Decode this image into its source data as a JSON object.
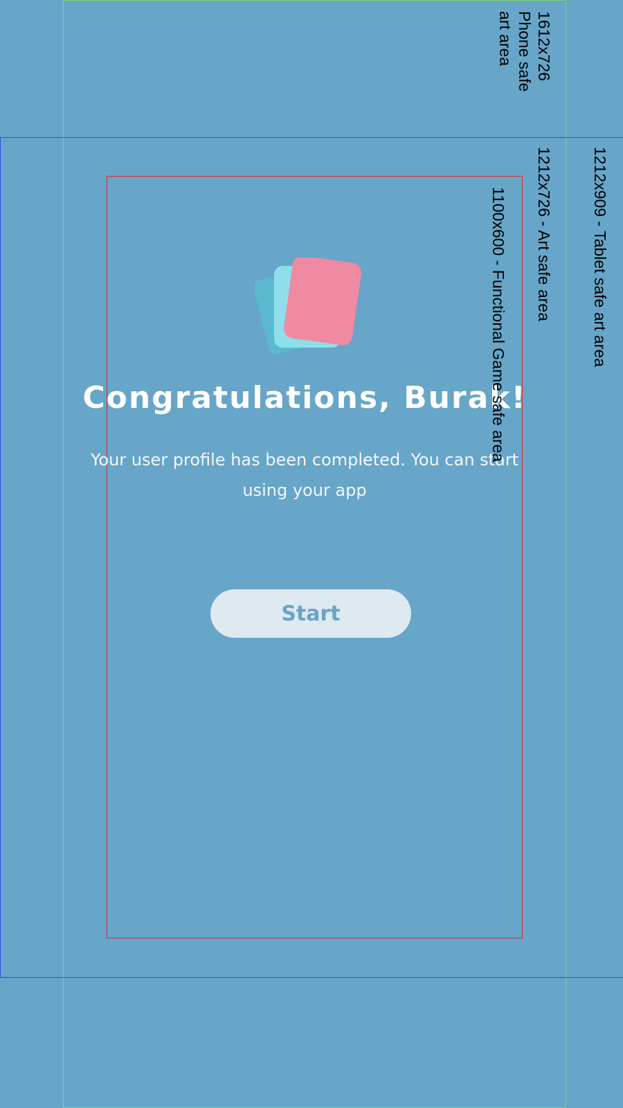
{
  "guides": {
    "phone_label": "1612x726\nPhone safe\nart area",
    "art_label": "1212x726 - Art safe area",
    "tablet_label": "1212x909 - Tablet safe art area",
    "functional_label": "1100x600 - Functional Game safe area"
  },
  "content": {
    "logo_icon": "stacked-cards-icon",
    "title": "Congratulations, Burak!",
    "message": "Your user profile has been completed. You can start using your app",
    "start_label": "Start"
  },
  "colors": {
    "background": "#67a5c9",
    "button_bg": "#dfe9f0",
    "button_text": "#67a5c9",
    "card_pink": "#ef8aa2",
    "card_teal_light": "#8edfeb",
    "card_teal_dark": "#5bb9cf"
  }
}
